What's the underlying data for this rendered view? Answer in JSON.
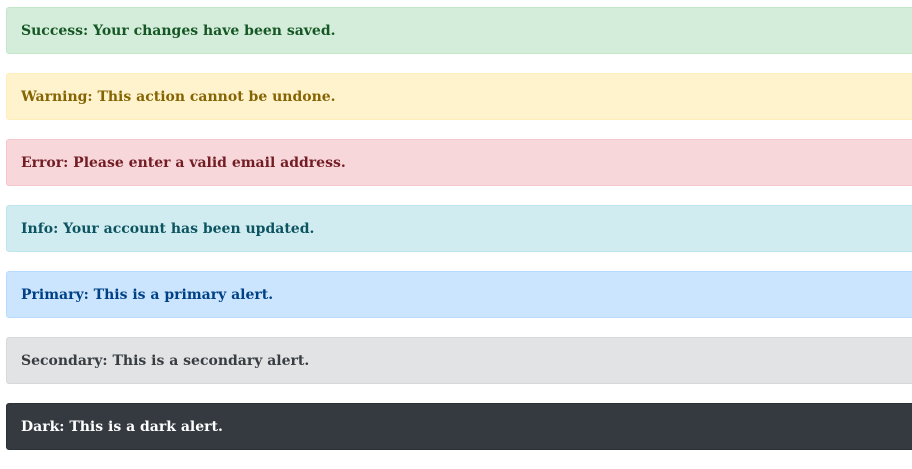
{
  "alerts": {
    "success": {
      "text": "Success: Your changes have been saved.",
      "color": "#155724",
      "background": "#d4edda"
    },
    "warning": {
      "text": "Warning: This action cannot be undone.",
      "color": "#856404",
      "background": "#fff3cd"
    },
    "error": {
      "text": "Error: Please enter a valid email address.",
      "color": "#721c24",
      "background": "#f8d7da"
    },
    "info": {
      "text": "Info: Your account has been updated.",
      "color": "#0c5460",
      "background": "#d1ecf1"
    },
    "primary": {
      "text": "Primary: This is a primary alert.",
      "color": "#004085",
      "background": "#cce5ff"
    },
    "secondary": {
      "text": "Secondary: This is a secondary alert.",
      "color": "#383d41",
      "background": "#e2e3e5"
    },
    "dark": {
      "text": "Dark: This is a dark alert.",
      "color": "#ffffff",
      "background": "#343a40"
    }
  }
}
